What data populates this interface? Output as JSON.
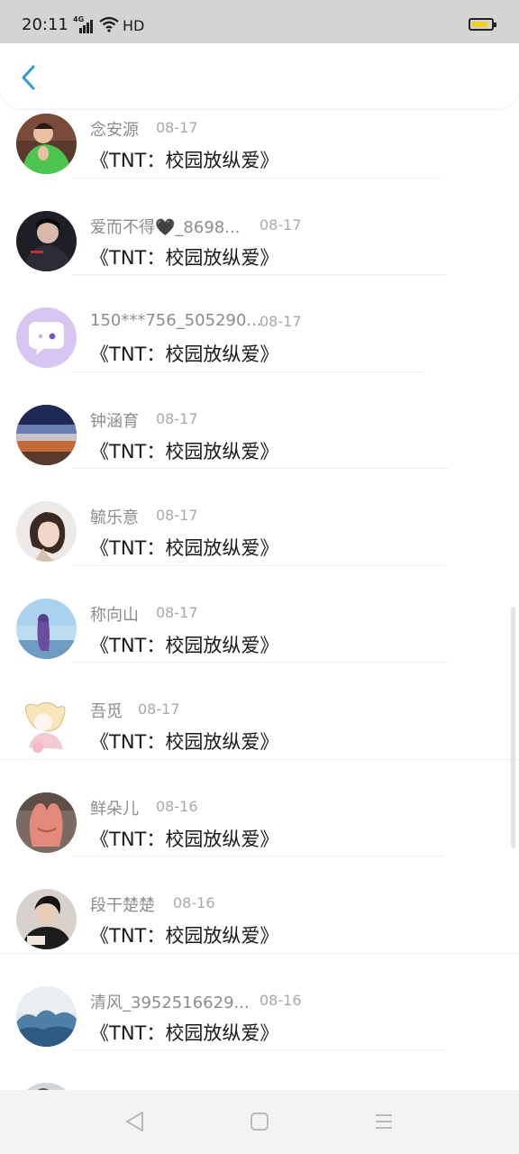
{
  "status_bar": {
    "time": "20:11",
    "network": "4G",
    "hd": "HD",
    "battery_color": "#f0d02a"
  },
  "header": {
    "back_icon": "chevron-left-icon",
    "accent_color": "#2f9bd6"
  },
  "list": [
    {
      "name": "念安源",
      "date": "08-17",
      "title": "《TNT：校园放纵爱》",
      "avatar": "person-green-shirt"
    },
    {
      "name": "爱而不得🖤_8698...",
      "date": "08-17",
      "title": "《TNT：校园放纵爱》",
      "avatar": "person-dark"
    },
    {
      "name": "150***756_505290...",
      "date": "08-17",
      "title": "《TNT：校园放纵爱》",
      "avatar": "default-chat-bubble"
    },
    {
      "name": "钟涵育",
      "date": "08-17",
      "title": "《TNT：校园放纵爱》",
      "avatar": "sunset-landscape"
    },
    {
      "name": "毓乐意",
      "date": "08-17",
      "title": "《TNT：校园放纵爱》",
      "avatar": "girl-portrait"
    },
    {
      "name": "称向山",
      "date": "08-17",
      "title": "《TNT：校园放纵爱》",
      "avatar": "sky-figure"
    },
    {
      "name": "吾觅",
      "date": "08-17",
      "title": "《TNT：校园放纵爱》",
      "avatar": "anime-drawing"
    },
    {
      "name": "鲜朵儿",
      "date": "08-16",
      "title": "《TNT：校园放纵爱》",
      "avatar": "peach-object"
    },
    {
      "name": "段干楚楚",
      "date": "08-16",
      "title": "《TNT：校园放纵爱》",
      "avatar": "boy-portrait"
    },
    {
      "name": "清风_3952516629...",
      "date": "08-16",
      "title": "《TNT：校园放纵爱》",
      "avatar": "ocean-clouds"
    },
    {
      "name": "",
      "date": "",
      "title": "",
      "avatar": "partial"
    }
  ],
  "nav_bar": {
    "back_icon": "triangle-back-icon",
    "home_icon": "square-home-icon",
    "menu_icon": "menu-lines-icon"
  }
}
